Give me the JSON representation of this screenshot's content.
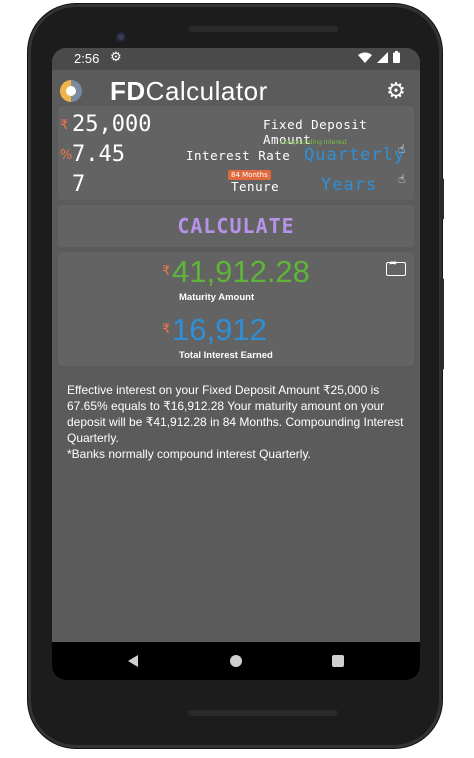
{
  "status": {
    "time": "2:56",
    "icons": [
      "gear-icon",
      "wifi-icon",
      "signal-icon",
      "battery-icon"
    ]
  },
  "app": {
    "title_bold": "FD",
    "title_rest": "Calculator"
  },
  "inputs": {
    "amount_symbol": "₹",
    "amount_value": "25,000",
    "amount_label": "Fixed Deposit Amount",
    "rate_symbol": "%",
    "rate_value": "7.45",
    "rate_label": "Interest Rate",
    "compounding_caption": "Compounding Interest",
    "compounding_value": "Quarterly",
    "tenure_value": "7",
    "tenure_badge": "84 Months",
    "tenure_label": "Tenure",
    "tenure_unit": "Years"
  },
  "calculate_label": "CALCULATE",
  "results": {
    "symbol": "₹",
    "maturity_value": "41,912.28",
    "maturity_label": "Maturity Amount",
    "interest_value": "16,912",
    "interest_label": "Total Interest Earned"
  },
  "description": {
    "line1": "Effective interest on your Fixed Deposit Amount ₹25,000 is 67.65% equals to ₹16,912.28 Your maturity amount on your deposit will be ₹41,912.28 in 84 Months. Compounding Interest Quarterly.",
    "line2": "*Banks normally compound interest Quarterly."
  },
  "colors": {
    "accent_orange": "#f2754b",
    "blue": "#2f8fd6",
    "green": "#5fb53a",
    "purple": "#b692e8"
  }
}
